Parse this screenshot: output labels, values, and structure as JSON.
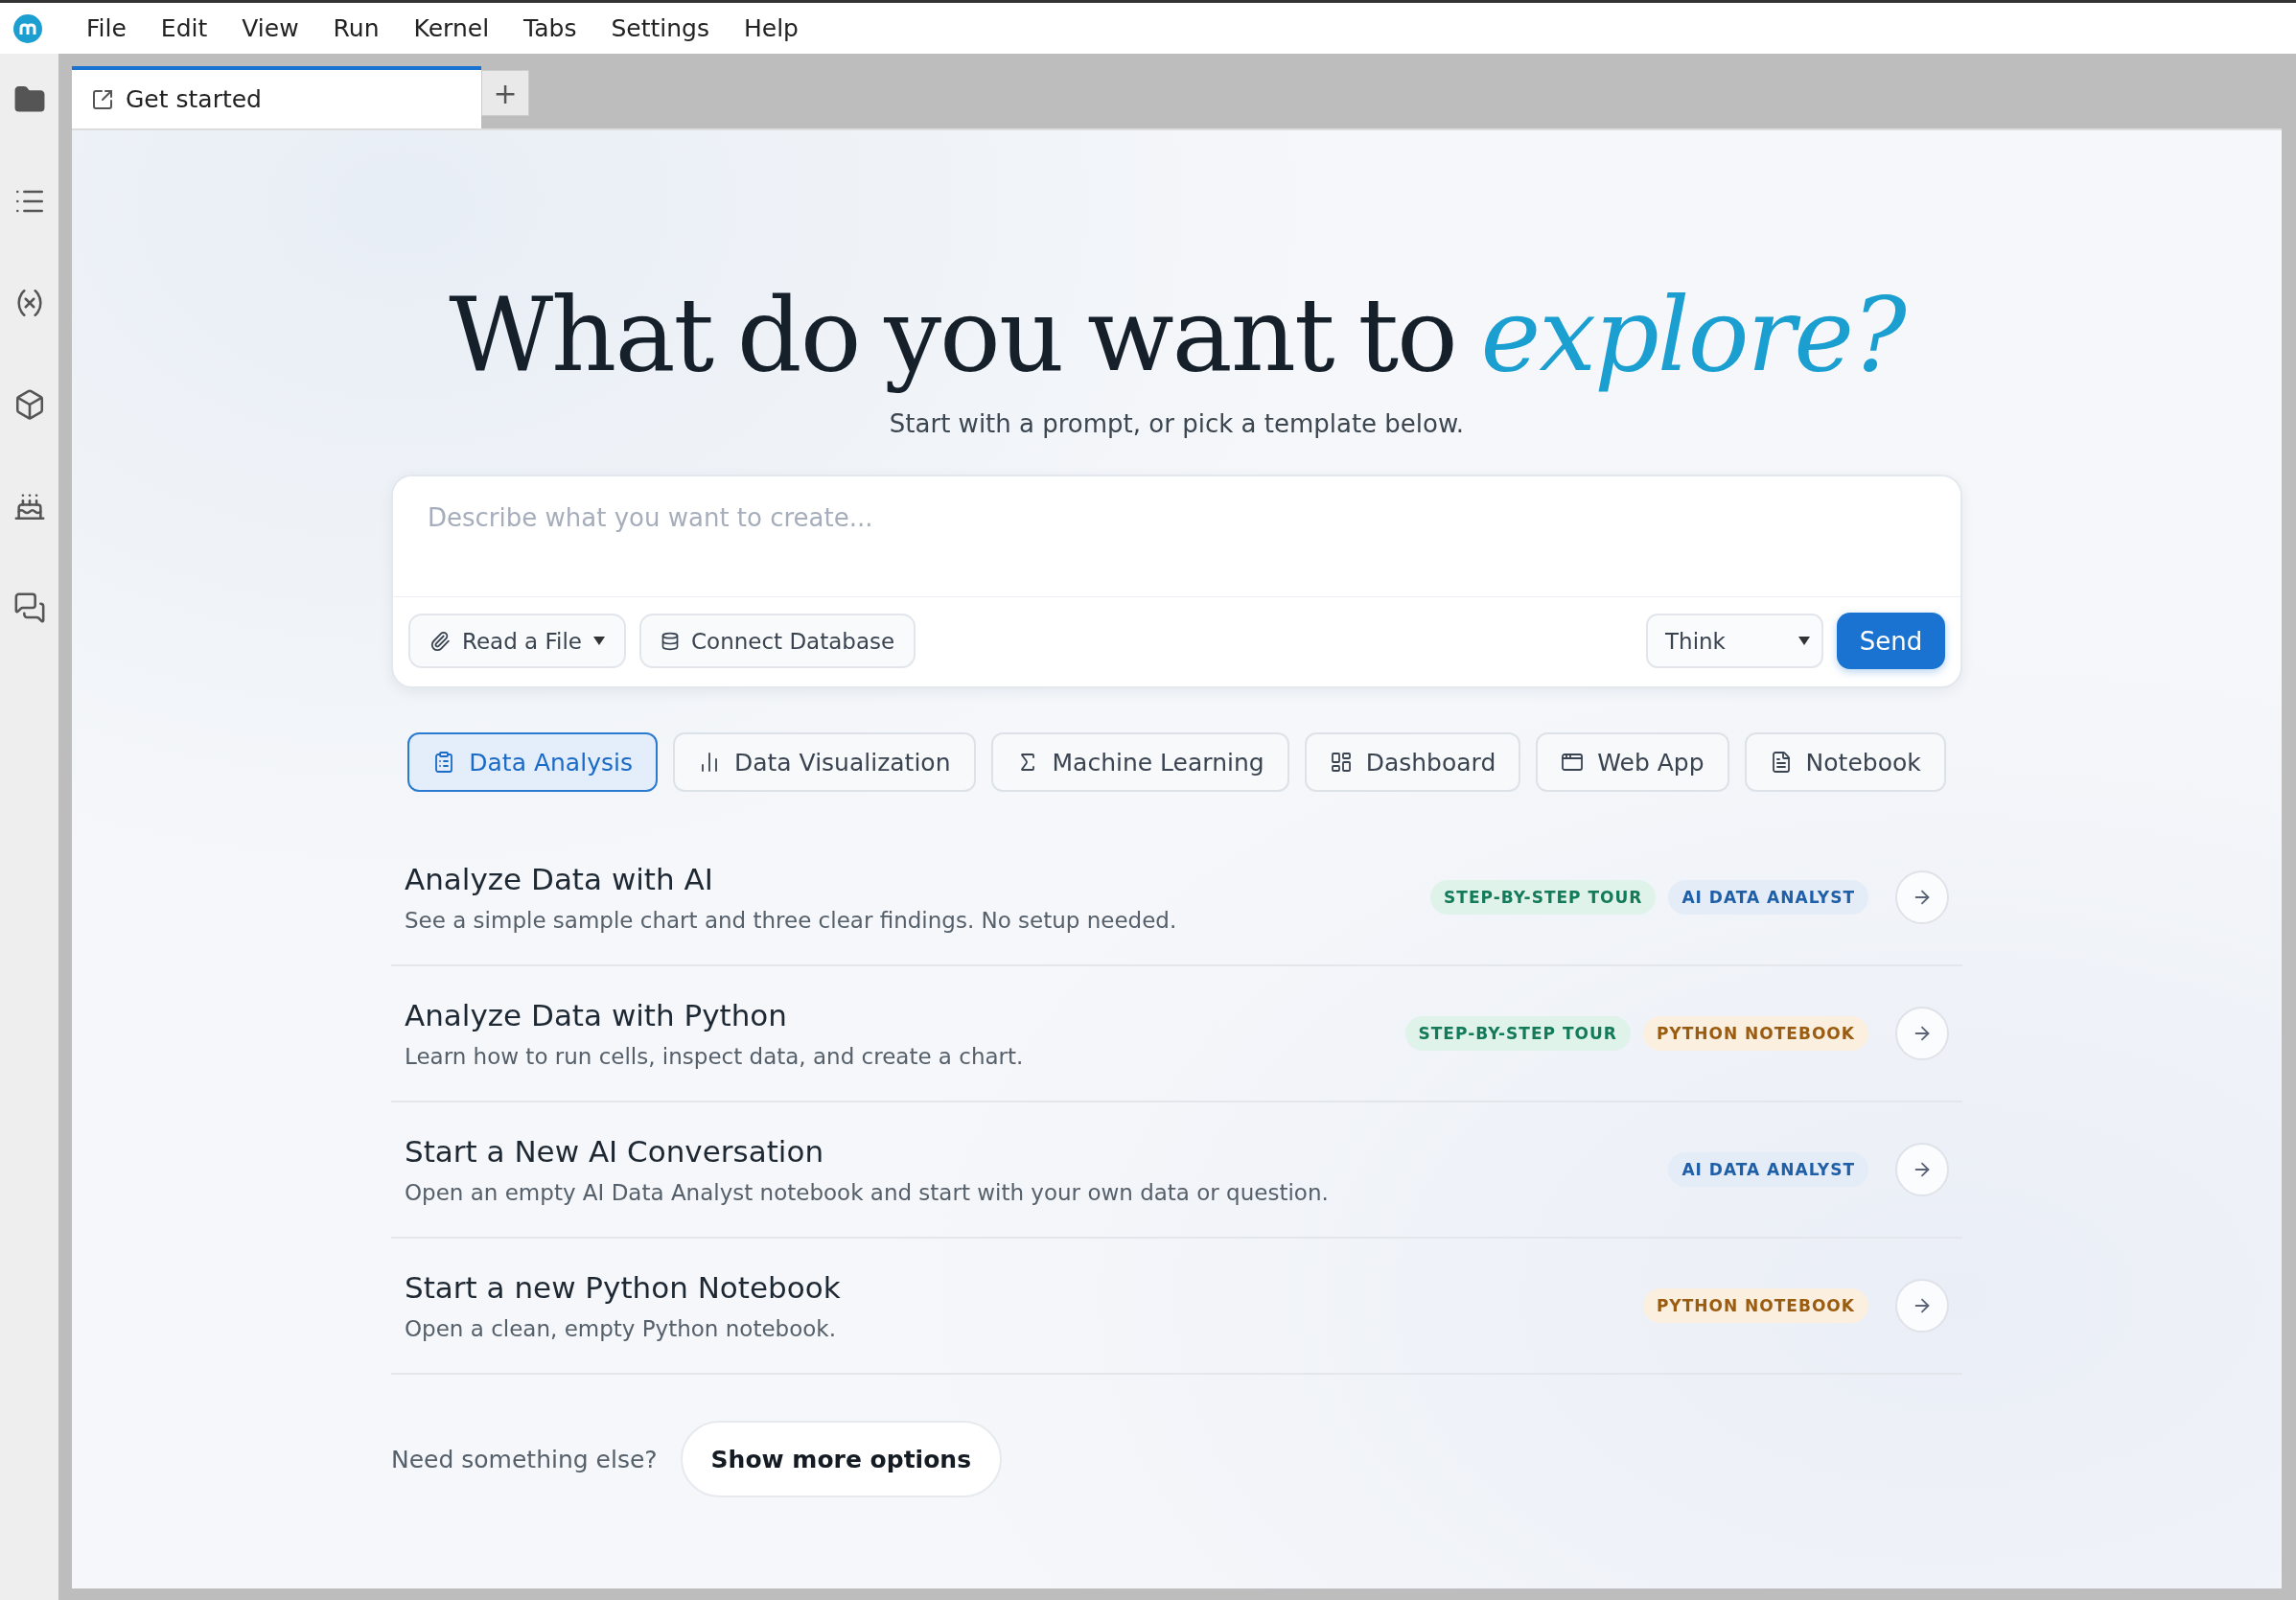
{
  "menu": [
    "File",
    "Edit",
    "View",
    "Run",
    "Kernel",
    "Tabs",
    "Settings",
    "Help"
  ],
  "tabs": [
    {
      "label": "Get started",
      "selected": true
    }
  ],
  "new_tab_button": "+",
  "heading": "What do you want to *explore?*",
  "subtitle": "Start with a prompt, or pick a template below.",
  "prompt": {
    "placeholder": "Describe what you want to create...",
    "read_file": "Read a File",
    "connect_database": "Connect Database",
    "mode": "Think",
    "send": "Send"
  },
  "categories": [
    {
      "label": "Data Analysis",
      "selected": true
    },
    {
      "label": "Data Visualization",
      "selected": false
    },
    {
      "label": "Machine Learning",
      "selected": false
    },
    {
      "label": "Dashboard",
      "selected": false
    },
    {
      "label": "Web App",
      "selected": false
    },
    {
      "label": "Notebook",
      "selected": false
    }
  ],
  "templates": [
    {
      "title": "Analyze Data with AI",
      "description": "See a simple sample chart and three clear findings. No setup needed.",
      "badges": [
        {
          "label": "STEP-BY-STEP TOUR",
          "kind": "tour"
        },
        {
          "label": "AI DATA ANALYST",
          "kind": "ai"
        }
      ]
    },
    {
      "title": "Analyze Data with Python",
      "description": "Learn how to run cells, inspect data, and create a chart.",
      "badges": [
        {
          "label": "STEP-BY-STEP TOUR",
          "kind": "tour"
        },
        {
          "label": "PYTHON NOTEBOOK",
          "kind": "python"
        }
      ]
    },
    {
      "title": "Start a New AI Conversation",
      "description": "Open an empty AI Data Analyst notebook and start with your own data or question.",
      "badges": [
        {
          "label": "AI DATA ANALYST",
          "kind": "ai"
        }
      ]
    },
    {
      "title": "Start a new Python Notebook",
      "description": "Open a clean, empty Python notebook.",
      "badges": [
        {
          "label": "PYTHON NOTEBOOK",
          "kind": "python"
        }
      ]
    }
  ],
  "footer": {
    "prompt": "Need something else?",
    "button": "Show more options"
  }
}
